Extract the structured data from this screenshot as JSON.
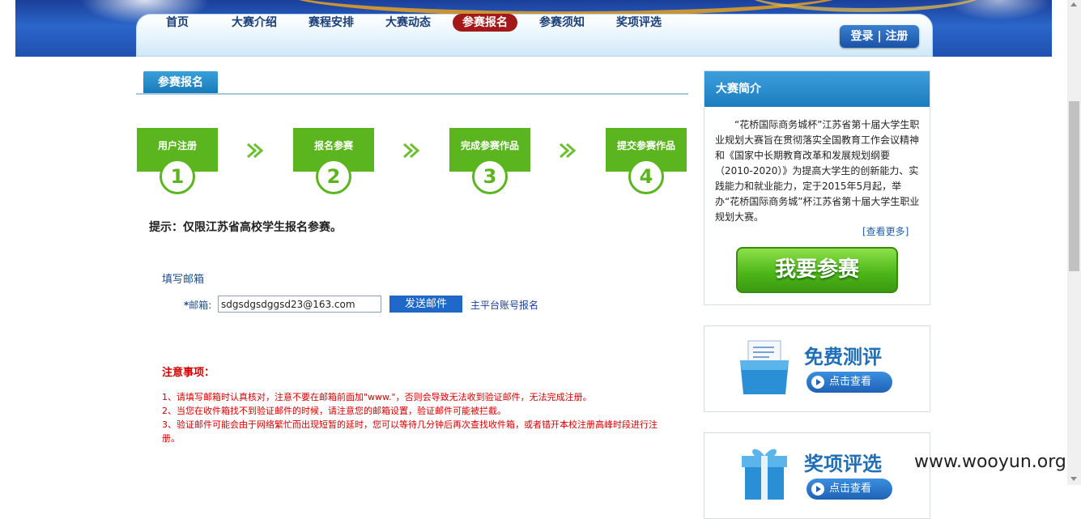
{
  "nav": {
    "items": [
      {
        "label": "首页"
      },
      {
        "label": "大赛介绍"
      },
      {
        "label": "赛程安排"
      },
      {
        "label": "大赛动态"
      },
      {
        "label": "参赛报名",
        "active": true
      },
      {
        "label": "参赛须知"
      },
      {
        "label": "奖项评选"
      }
    ],
    "login_label": "登录",
    "separator": "|",
    "register_label": "注册",
    "active_color": "#a31818"
  },
  "section": {
    "title": "参赛报名"
  },
  "steps": [
    {
      "label": "用户注册",
      "number": "1"
    },
    {
      "label": "报名参赛",
      "number": "2"
    },
    {
      "label": "完成参赛作品",
      "number": "3"
    },
    {
      "label": "提交参赛作品",
      "number": "4"
    }
  ],
  "step_arrow_icon": "double-arrow-right-icon",
  "step_color": "#5ab51e",
  "tip": "提示：仅限江苏省高校学生报名参赛。",
  "form": {
    "section_label": "填写邮箱",
    "email_label_required": "*",
    "email_label": "邮箱:",
    "email_value": "sdgsdgsdggsd23@163.com",
    "send_button": "发送邮件",
    "platform_link": "主平台账号报名"
  },
  "notice": {
    "title": "注意事项：",
    "lines": [
      "1、请填写邮箱时认真核对，注意不要在邮箱前面加\"www.\"，否则会导致无法收到验证邮件，无法完成注册。",
      "2、当您在收件箱找不到验证邮件的时候，请注意您的邮箱设置，验证邮件可能被拦截。",
      "3、验证邮件可能会由于网络繁忙而出现短暂的延时，您可以等待几分钟后再次查找收件箱，或者错开本校注册高峰时段进行注册。"
    ],
    "color": "#d40000"
  },
  "intro": {
    "title": "大赛简介",
    "text": "“花桥国际商务城杯”江苏省第十届大学生职业规划大赛旨在贯彻落实全国教育工作会议精神和《国家中长期教育改革和发展规划纲要（2010-2020）》为提高大学生的创新能力、实践能力和就业能力，定于2015年5月起，举办“花桥国际商务城”杯江苏省第十届大学生职业规划大赛。",
    "more_link": "[查看更多]",
    "join_button": "我要参赛"
  },
  "promos": [
    {
      "title": "免费测评",
      "button": "点击查看",
      "icon": "folder-documents-icon"
    },
    {
      "title": "奖项评选",
      "button": "点击查看",
      "icon": "gift-box-icon"
    }
  ],
  "watermark": "www.wooyun.org"
}
